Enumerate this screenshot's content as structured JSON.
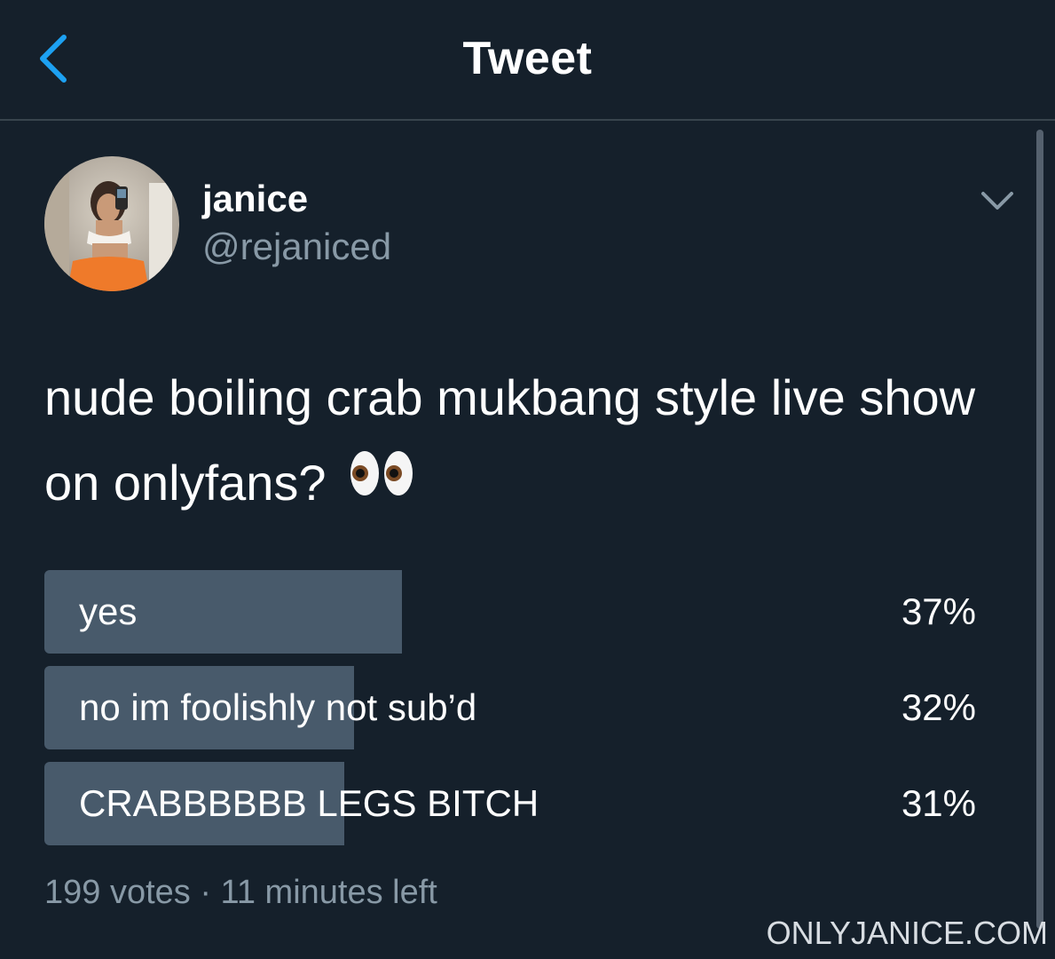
{
  "header": {
    "title": "Tweet",
    "back_icon": "chevron-left-icon"
  },
  "tweet": {
    "author": {
      "display_name": "janice",
      "handle": "@rejaniced"
    },
    "more_icon": "chevron-down-icon",
    "text": "nude boiling crab mukbang style live show on onlyfans?",
    "emoji_icon": "eyes-emoji-icon"
  },
  "poll": {
    "options": [
      {
        "label": "yes",
        "percent_text": "37%",
        "percent": 37
      },
      {
        "label": "no im foolishly not sub’d",
        "percent_text": "32%",
        "percent": 32
      },
      {
        "label": "CRABBBBBB LEGS BITCH",
        "percent_text": "31%",
        "percent": 31
      }
    ],
    "meta": "199 votes · 11 minutes left"
  },
  "watermark": "ONLYJANICE.COM",
  "colors": {
    "background": "#15202b",
    "divider": "#38444d",
    "accent": "#1da1f2",
    "secondary_text": "#8899a6",
    "poll_fill": "#485a6b"
  }
}
